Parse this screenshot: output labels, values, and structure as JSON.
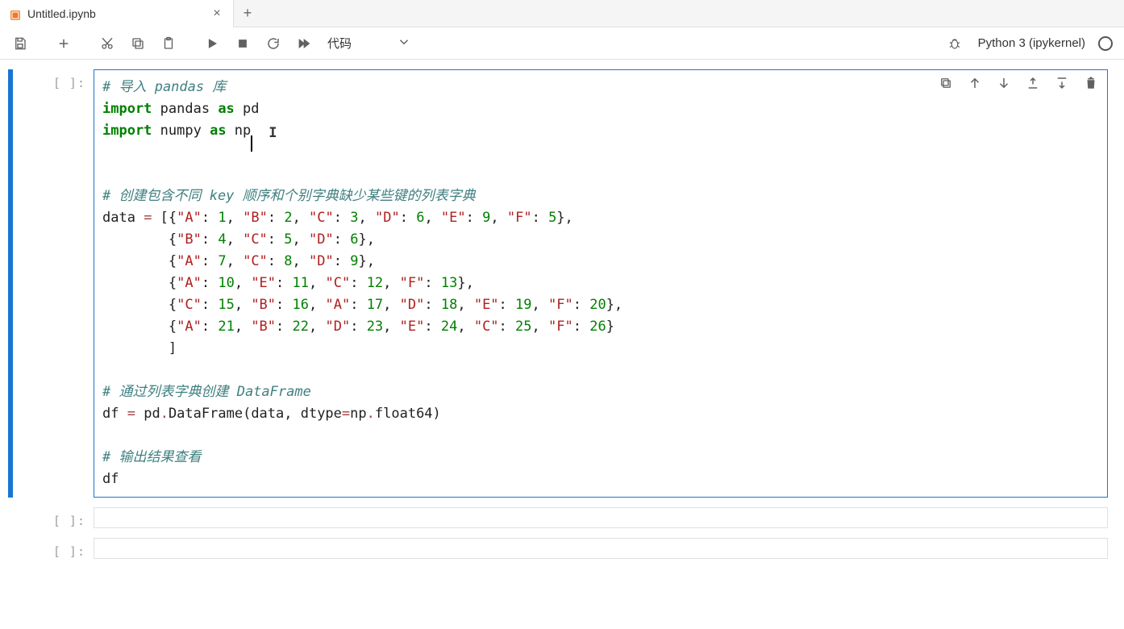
{
  "tab": {
    "title": "Untitled.ipynb"
  },
  "toolbar": {
    "celltype_label": "代码"
  },
  "kernel": {
    "name": "Python 3 (ipykernel)"
  },
  "cells": {
    "active_prompt": "[ ]:",
    "empty_prompt": "[ ]:"
  },
  "code": {
    "l1": "# 导入 pandas 库",
    "l2a": "import",
    "l2b": " pandas ",
    "l2c": "as",
    "l2d": " pd",
    "l3a": "import",
    "l3b": " numpy ",
    "l3c": "as",
    "l3d": " np",
    "l5": "# 创建包含不同 key 顺序和个别字典缺少某些键的列表字典",
    "l6pre": "data ",
    "l6eq": "=",
    "l6sp": " [",
    "l6a": "{",
    "l6k1": "\"A\"",
    "l6c": ": ",
    "l6v1": "1",
    "l6s": ", ",
    "l6k2": "\"B\"",
    "l6v2": "2",
    "l6k3": "\"C\"",
    "l6v3": "3",
    "l6k4": "\"D\"",
    "l6v4": "6",
    "l6k5": "\"E\"",
    "l6v5": "9",
    "l6k6": "\"F\"",
    "l6v6": "5",
    "l6end": "},",
    "l7a": "{",
    "l7k1": "\"B\"",
    "l7v1": "4",
    "l7k2": "\"C\"",
    "l7v2": "5",
    "l7k3": "\"D\"",
    "l7v3": "6",
    "l7end": "},",
    "l8a": "{",
    "l8k1": "\"A\"",
    "l8v1": "7",
    "l8k2": "\"C\"",
    "l8v2": "8",
    "l8k3": "\"D\"",
    "l8v3": "9",
    "l8end": "},",
    "l9a": "{",
    "l9k1": "\"A\"",
    "l9v1": "10",
    "l9k2": "\"E\"",
    "l9v2": "11",
    "l9k3": "\"C\"",
    "l9v3": "12",
    "l9k4": "\"F\"",
    "l9v4": "13",
    "l9end": "},",
    "l10a": "{",
    "l10k1": "\"C\"",
    "l10v1": "15",
    "l10k2": "\"B\"",
    "l10v2": "16",
    "l10k3": "\"A\"",
    "l10v3": "17",
    "l10k4": "\"D\"",
    "l10v4": "18",
    "l10k5": "\"E\"",
    "l10v5": "19",
    "l10k6": "\"F\"",
    "l10v6": "20",
    "l10end": "},",
    "l11a": "{",
    "l11k1": "\"A\"",
    "l11v1": "21",
    "l11k2": "\"B\"",
    "l11v2": "22",
    "l11k3": "\"D\"",
    "l11v3": "23",
    "l11k4": "\"E\"",
    "l11v4": "24",
    "l11k5": "\"C\"",
    "l11v5": "25",
    "l11k6": "\"F\"",
    "l11v6": "26",
    "l11end": "}",
    "l12": "        ]",
    "l14": "# 通过列表字典创建 DataFrame",
    "l15a": "df ",
    "l15eq": "=",
    "l15sp": " pd",
    "l15dot": ".",
    "l15fn": "DataFrame",
    "l15op": "(",
    "l15arg": "data, dtype",
    "l15eq2": "=",
    "l15np": "np",
    "l15dot2": ".",
    "l15f64": "float64",
    "l15cl": ")",
    "l17": "# 输出结果查看",
    "l18": "df",
    "indent": "        "
  }
}
